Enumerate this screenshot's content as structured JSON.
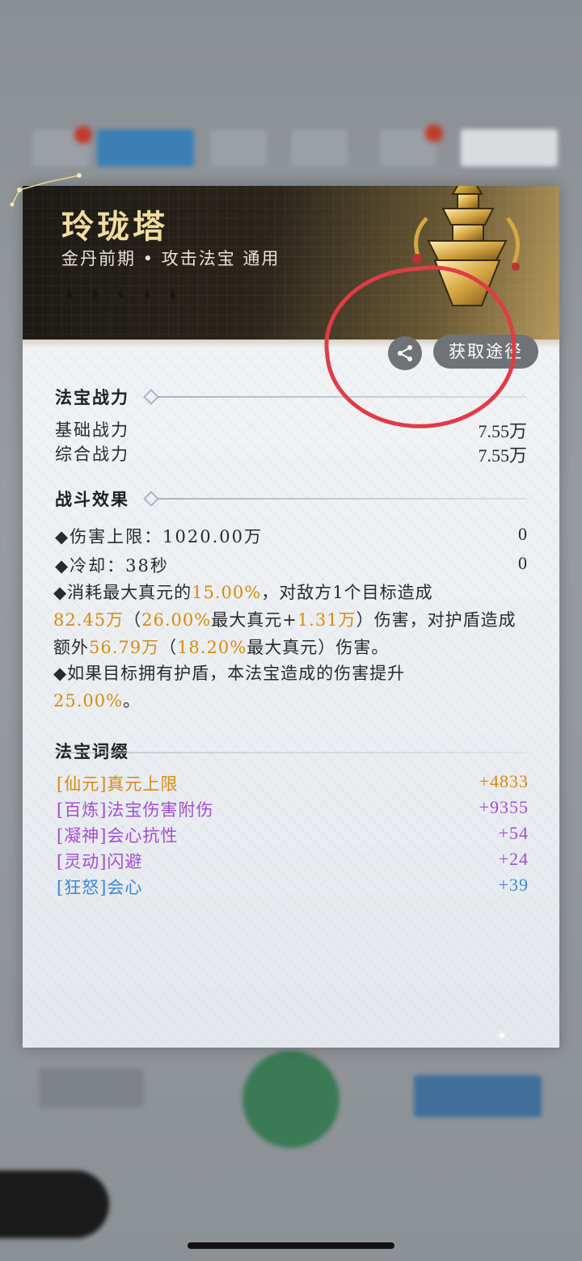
{
  "item": {
    "name": "玲珑塔",
    "subtitle": "金丹前期 • 攻击法宝 通用",
    "share_icon": "share-icon",
    "obtain_label": "获取途径"
  },
  "power": {
    "heading": "法宝战力",
    "base_label": "基础战力",
    "base_value": "7.55万",
    "total_label": "综合战力",
    "total_value": "7.55万"
  },
  "effects": {
    "heading": "战斗效果",
    "damage_cap_label": "◆伤害上限：1020.00万",
    "damage_cap_value": "0",
    "cooldown_label": "◆冷却：38秒",
    "cooldown_value": "0",
    "desc1": {
      "p1": "◆消耗最大真元的",
      "h1": "15.00%",
      "p2": "，对敌方1个目标造成",
      "h2": "82.45万",
      "p3": "（",
      "h3": "26.00%",
      "p4": "最大真元+",
      "h4": "1.31万",
      "p5": "）伤害，对护盾造成额外",
      "h5": "56.79万",
      "p6": "（",
      "h6": "18.20%",
      "p7": "最大真元）伤害。"
    },
    "desc2": {
      "p1": "◆如果目标拥有护盾，本法宝造成的伤害提升",
      "h1": "25.00%",
      "p2": "。"
    }
  },
  "affixes": {
    "heading": "法宝词缀",
    "items": [
      {
        "label": "[仙元]真元上限",
        "value": "+4833",
        "color": "#d88a10"
      },
      {
        "label": "[百炼]法宝伤害附伤",
        "value": "+9355",
        "color": "#a24fd0"
      },
      {
        "label": "[凝神]会心抗性",
        "value": "+54",
        "color": "#a24fd0"
      },
      {
        "label": "[灵动]闪避",
        "value": "+24",
        "color": "#a24fd0"
      },
      {
        "label": "[狂怒]会心",
        "value": "+39",
        "color": "#3a8ad8"
      }
    ]
  },
  "colors": {
    "highlight": "#d88a10",
    "annotation": "#e03c46"
  }
}
